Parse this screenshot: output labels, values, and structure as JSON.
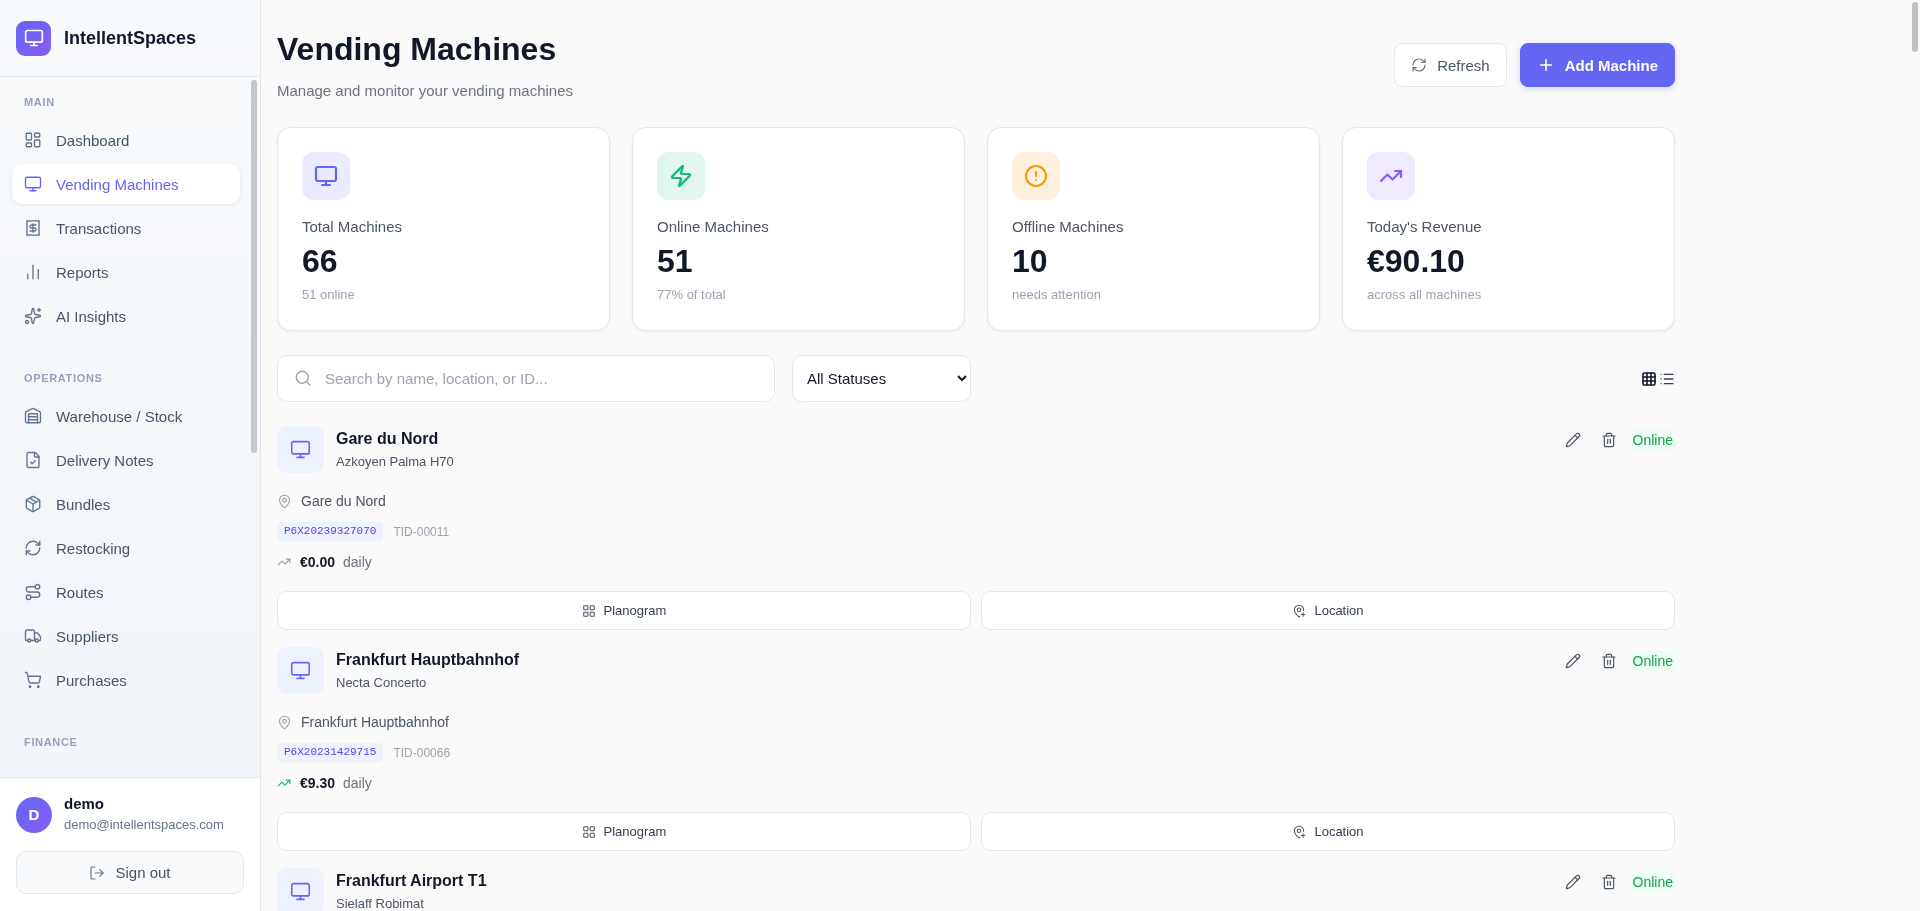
{
  "sidebar": {
    "brand": "IntellentSpaces",
    "sections": [
      {
        "title": "MAIN",
        "items": [
          {
            "label": "Dashboard",
            "selected": false
          },
          {
            "label": "Vending Machines",
            "selected": true
          },
          {
            "label": "Transactions",
            "selected": false
          },
          {
            "label": "Reports",
            "selected": false
          },
          {
            "label": "AI Insights",
            "selected": false
          }
        ]
      },
      {
        "title": "OPERATIONS",
        "items": [
          {
            "label": "Warehouse / Stock",
            "selected": false
          },
          {
            "label": "Delivery Notes",
            "selected": false
          },
          {
            "label": "Bundles",
            "selected": false
          },
          {
            "label": "Restocking",
            "selected": false
          },
          {
            "label": "Routes",
            "selected": false
          },
          {
            "label": "Suppliers",
            "selected": false
          },
          {
            "label": "Purchases",
            "selected": false
          }
        ]
      },
      {
        "title": "FINANCE"
      }
    ],
    "user": {
      "initial": "D",
      "name": "demo",
      "email": "demo@intellentspaces.com"
    },
    "sign_out": "Sign out"
  },
  "header": {
    "title": "Vending Machines",
    "subtitle": "Manage and monitor your vending machines",
    "buttons": [
      {
        "label": "Refresh",
        "kind": "secondary"
      },
      {
        "label": "Add Machine",
        "kind": "primary"
      }
    ]
  },
  "stats": [
    {
      "label": "Total Machines",
      "value": "66",
      "note": "51 online",
      "color": "#6366f1"
    },
    {
      "label": "Online Machines",
      "value": "51",
      "note": "77% of total",
      "color": "#10b981"
    },
    {
      "label": "Offline Machines",
      "value": "10",
      "note": "needs attention",
      "color": "#f59e0b"
    },
    {
      "label": "Today's Revenue",
      "value": "€90.10",
      "note": "across all machines",
      "color": "#8b5cf6"
    }
  ],
  "filters": {
    "search": {
      "placeholder": "Search by name, location, or ID..."
    },
    "status": {
      "value": "All Statuses"
    }
  },
  "machines": [
    {
      "name": "Gare du Nord",
      "model": "Azkoyen Palma H70",
      "status": "Online",
      "online": true,
      "location": "Gare du Nord",
      "serial": "P6X20239327070",
      "terminal": "TID-00011",
      "revenue": {
        "amount": "€0.00",
        "period": "daily",
        "trending_up": false
      },
      "actions": [
        {
          "label": "Planogram"
        },
        {
          "label": "Location"
        }
      ]
    },
    {
      "name": "Frankfurt Hauptbahnhof",
      "model": "Necta Concerto",
      "status": "Online",
      "online": true,
      "location": "Frankfurt Hauptbahnhof",
      "serial": "P6X20231429715",
      "terminal": "TID-00066",
      "revenue": {
        "amount": "€9.30",
        "period": "daily",
        "trending_up": true
      },
      "actions": [
        {
          "label": "Planogram"
        },
        {
          "label": "Location"
        }
      ]
    },
    {
      "name": "Frankfurt Airport T1",
      "model": "Sielaff Robimat",
      "status": "Online",
      "online": true
    }
  ]
}
